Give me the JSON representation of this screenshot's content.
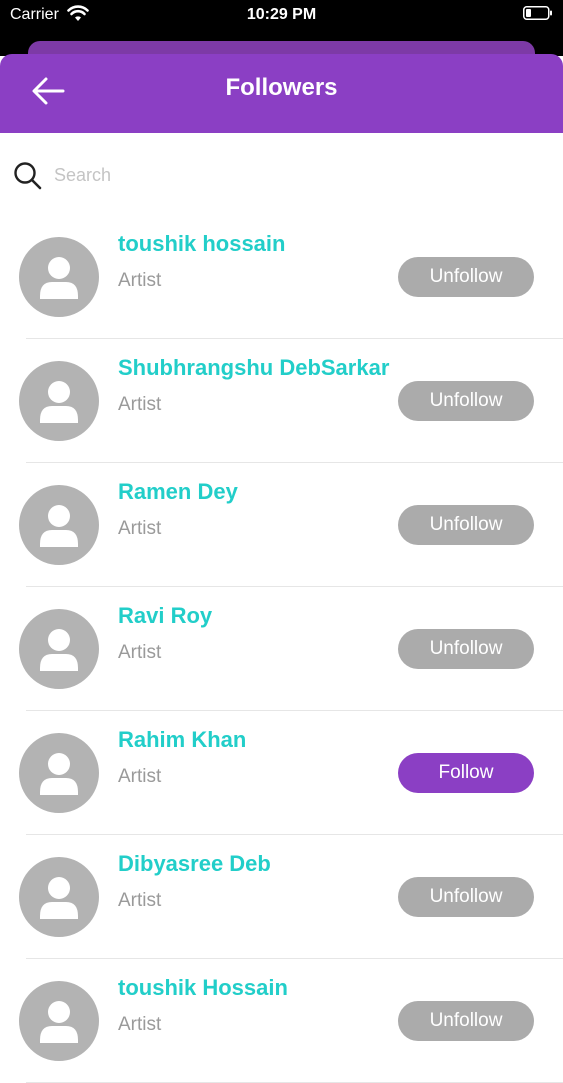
{
  "status_bar": {
    "carrier": "Carrier",
    "time": "10:29 PM"
  },
  "header": {
    "title": "Followers",
    "back_icon": "arrow-left-icon"
  },
  "search": {
    "placeholder": "Search",
    "value": "",
    "icon": "search-icon"
  },
  "followers": [
    {
      "name": "toushik hossain",
      "role": "Artist",
      "button": "Unfollow",
      "following": true
    },
    {
      "name": "Shubhrangshu DebSarkar",
      "role": "Artist",
      "button": "Unfollow",
      "following": true
    },
    {
      "name": "Ramen Dey",
      "role": "Artist",
      "button": "Unfollow",
      "following": true
    },
    {
      "name": "Ravi Roy",
      "role": "Artist",
      "button": "Unfollow",
      "following": true
    },
    {
      "name": "Rahim Khan",
      "role": "Artist",
      "button": "Follow",
      "following": false
    },
    {
      "name": "Dibyasree Deb",
      "role": "Artist",
      "button": "Unfollow",
      "following": true
    },
    {
      "name": "toushik Hossain",
      "role": "Artist",
      "button": "Unfollow",
      "following": true
    }
  ],
  "colors": {
    "header": "#8b3fc4",
    "name_text": "#22cec9",
    "role_text": "#9a9a9a",
    "unfollow_button": "#ababab",
    "follow_button": "#8b3fc4",
    "avatar": "#b3b3b3"
  }
}
